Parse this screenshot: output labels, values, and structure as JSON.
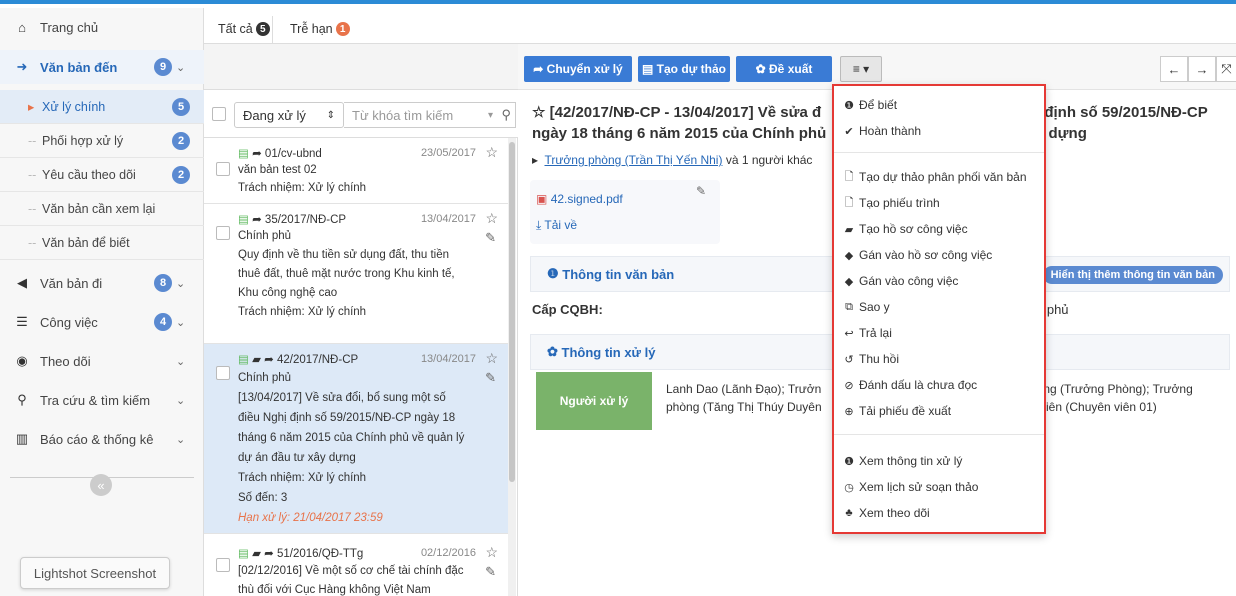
{
  "sidebar": {
    "home": "Trang chủ",
    "incoming": {
      "label": "Văn bản đến",
      "badge": "9"
    },
    "sub": [
      {
        "label": "Xử lý chính",
        "badge": "5"
      },
      {
        "label": "Phối hợp xử lý",
        "badge": "2"
      },
      {
        "label": "Yêu cầu theo dõi",
        "badge": "2"
      },
      {
        "label": "Văn bản cần xem lại",
        "badge": ""
      },
      {
        "label": "Văn bản để biết",
        "badge": ""
      }
    ],
    "outgoing": {
      "label": "Văn bản đi",
      "badge": "8"
    },
    "work": {
      "label": "Công việc",
      "badge": "4"
    },
    "follow": "Theo dõi",
    "search": "Tra cứu & tìm kiếm",
    "report": "Báo cáo & thống kê",
    "collapse": "«",
    "tooltip": "Lightshot Screenshot"
  },
  "tabs": [
    {
      "label": "Tất cả",
      "count": "5"
    },
    {
      "label": "Trễ hạn",
      "count": "1"
    }
  ],
  "filter": {
    "status": "Đang xử lý",
    "search_placeholder": "Từ khóa tìm kiếm"
  },
  "items": [
    {
      "code": "01/cv-ubnd",
      "date": "23/05/2017",
      "lines": [
        "văn bản test 02",
        "Trách nhiệm: Xử lý chính"
      ]
    },
    {
      "code": "35/2017/NĐ-CP",
      "date": "13/04/2017",
      "lines": [
        "Chính phủ",
        "Quy định về thu tiền sử dụng đất, thu tiền",
        "thuê đất, thuê mặt nước trong Khu kinh tế,",
        "Khu công nghệ cao",
        "Trách nhiệm: Xử lý chính"
      ]
    },
    {
      "code": "42/2017/NĐ-CP",
      "date": "13/04/2017",
      "lines": [
        "Chính phủ",
        "[13/04/2017] Về sửa đổi, bổ sung một số",
        "điều Nghị định số 59/2015/NĐ-CP ngày 18",
        "tháng 6 năm 2015 của Chính phủ về quản lý",
        "dự án đầu tư xây dựng",
        "Trách nhiệm: Xử lý chính",
        "Số đến: 3"
      ],
      "deadline": "Hạn xử lý: 21/04/2017 23:59"
    },
    {
      "code": "51/2016/QĐ-TTg",
      "date": "02/12/2016",
      "lines": [
        "[02/12/2016] Về một số cơ chế tài chính đặc",
        "thù đối với Cục Hàng không Việt Nam"
      ]
    }
  ],
  "toolbar": {
    "forward": "Chuyển xử lý",
    "draft": "Tạo dự thảo",
    "propose": "Đề xuất"
  },
  "detail": {
    "title_line1": "☆ [42/2017/NĐ-CP - 13/04/2017] Về sửa đ",
    "title_line1b": "i định số 59/2015/NĐ-CP",
    "title_line2": "ngày 18 tháng 6 năm 2015 của Chính phủ",
    "title_line2b": "y dựng",
    "person": "Trưởng phòng (Trần Thị Yến Nhi)",
    "person_more": "và 1 người khác",
    "file": "42.signed.pdf",
    "download": "Tải về",
    "info_head": "Thông tin văn bản",
    "more_info": "Hiển thị thêm thông tin văn bản",
    "cqbh": "Cấp CQBH:",
    "cqbh_val": "h phủ",
    "process_head": "Thông tin xử lý",
    "handler": "Người xử lý",
    "handler_text1": "Lanh Dao (Lãnh Đạo); Trưởn",
    "handler_text2": "phòng (Tăng Thị Thúy Duyên",
    "handler_text3": "hòng (Trưởng Phòng); Trưởng",
    "handler_text4": "n viên (Chuyên viên 01)"
  },
  "menu": [
    {
      "icon": "❶",
      "label": "Để biết"
    },
    {
      "icon": "✔",
      "label": "Hoàn thành"
    },
    {
      "icon": "🗋",
      "label": "Tạo dự thảo phân phối văn bản"
    },
    {
      "icon": "🗋",
      "label": "Tạo phiếu trình"
    },
    {
      "icon": "▰",
      "label": "Tạo hồ sơ công việc"
    },
    {
      "icon": "◆",
      "label": "Gán vào hồ sơ công việc"
    },
    {
      "icon": "◆",
      "label": "Gán vào công việc"
    },
    {
      "icon": "⧉",
      "label": "Sao y"
    },
    {
      "icon": "↩",
      "label": "Trả lại"
    },
    {
      "icon": "↺",
      "label": "Thu hồi"
    },
    {
      "icon": "⊘",
      "label": "Đánh dấu là chưa đọc"
    },
    {
      "icon": "⊕",
      "label": "Tải phiếu đề xuất"
    },
    {
      "icon": "❶",
      "label": "Xem thông tin xử lý"
    },
    {
      "icon": "◷",
      "label": "Xem lịch sử soạn thảo"
    },
    {
      "icon": "♣",
      "label": "Xem theo dõi"
    }
  ],
  "colors": {
    "accent": "#3a7bd5",
    "badge": "#5b8ad1",
    "alert": "#e8734a",
    "highlight": "#e53935",
    "handler": "#7ab36a"
  }
}
